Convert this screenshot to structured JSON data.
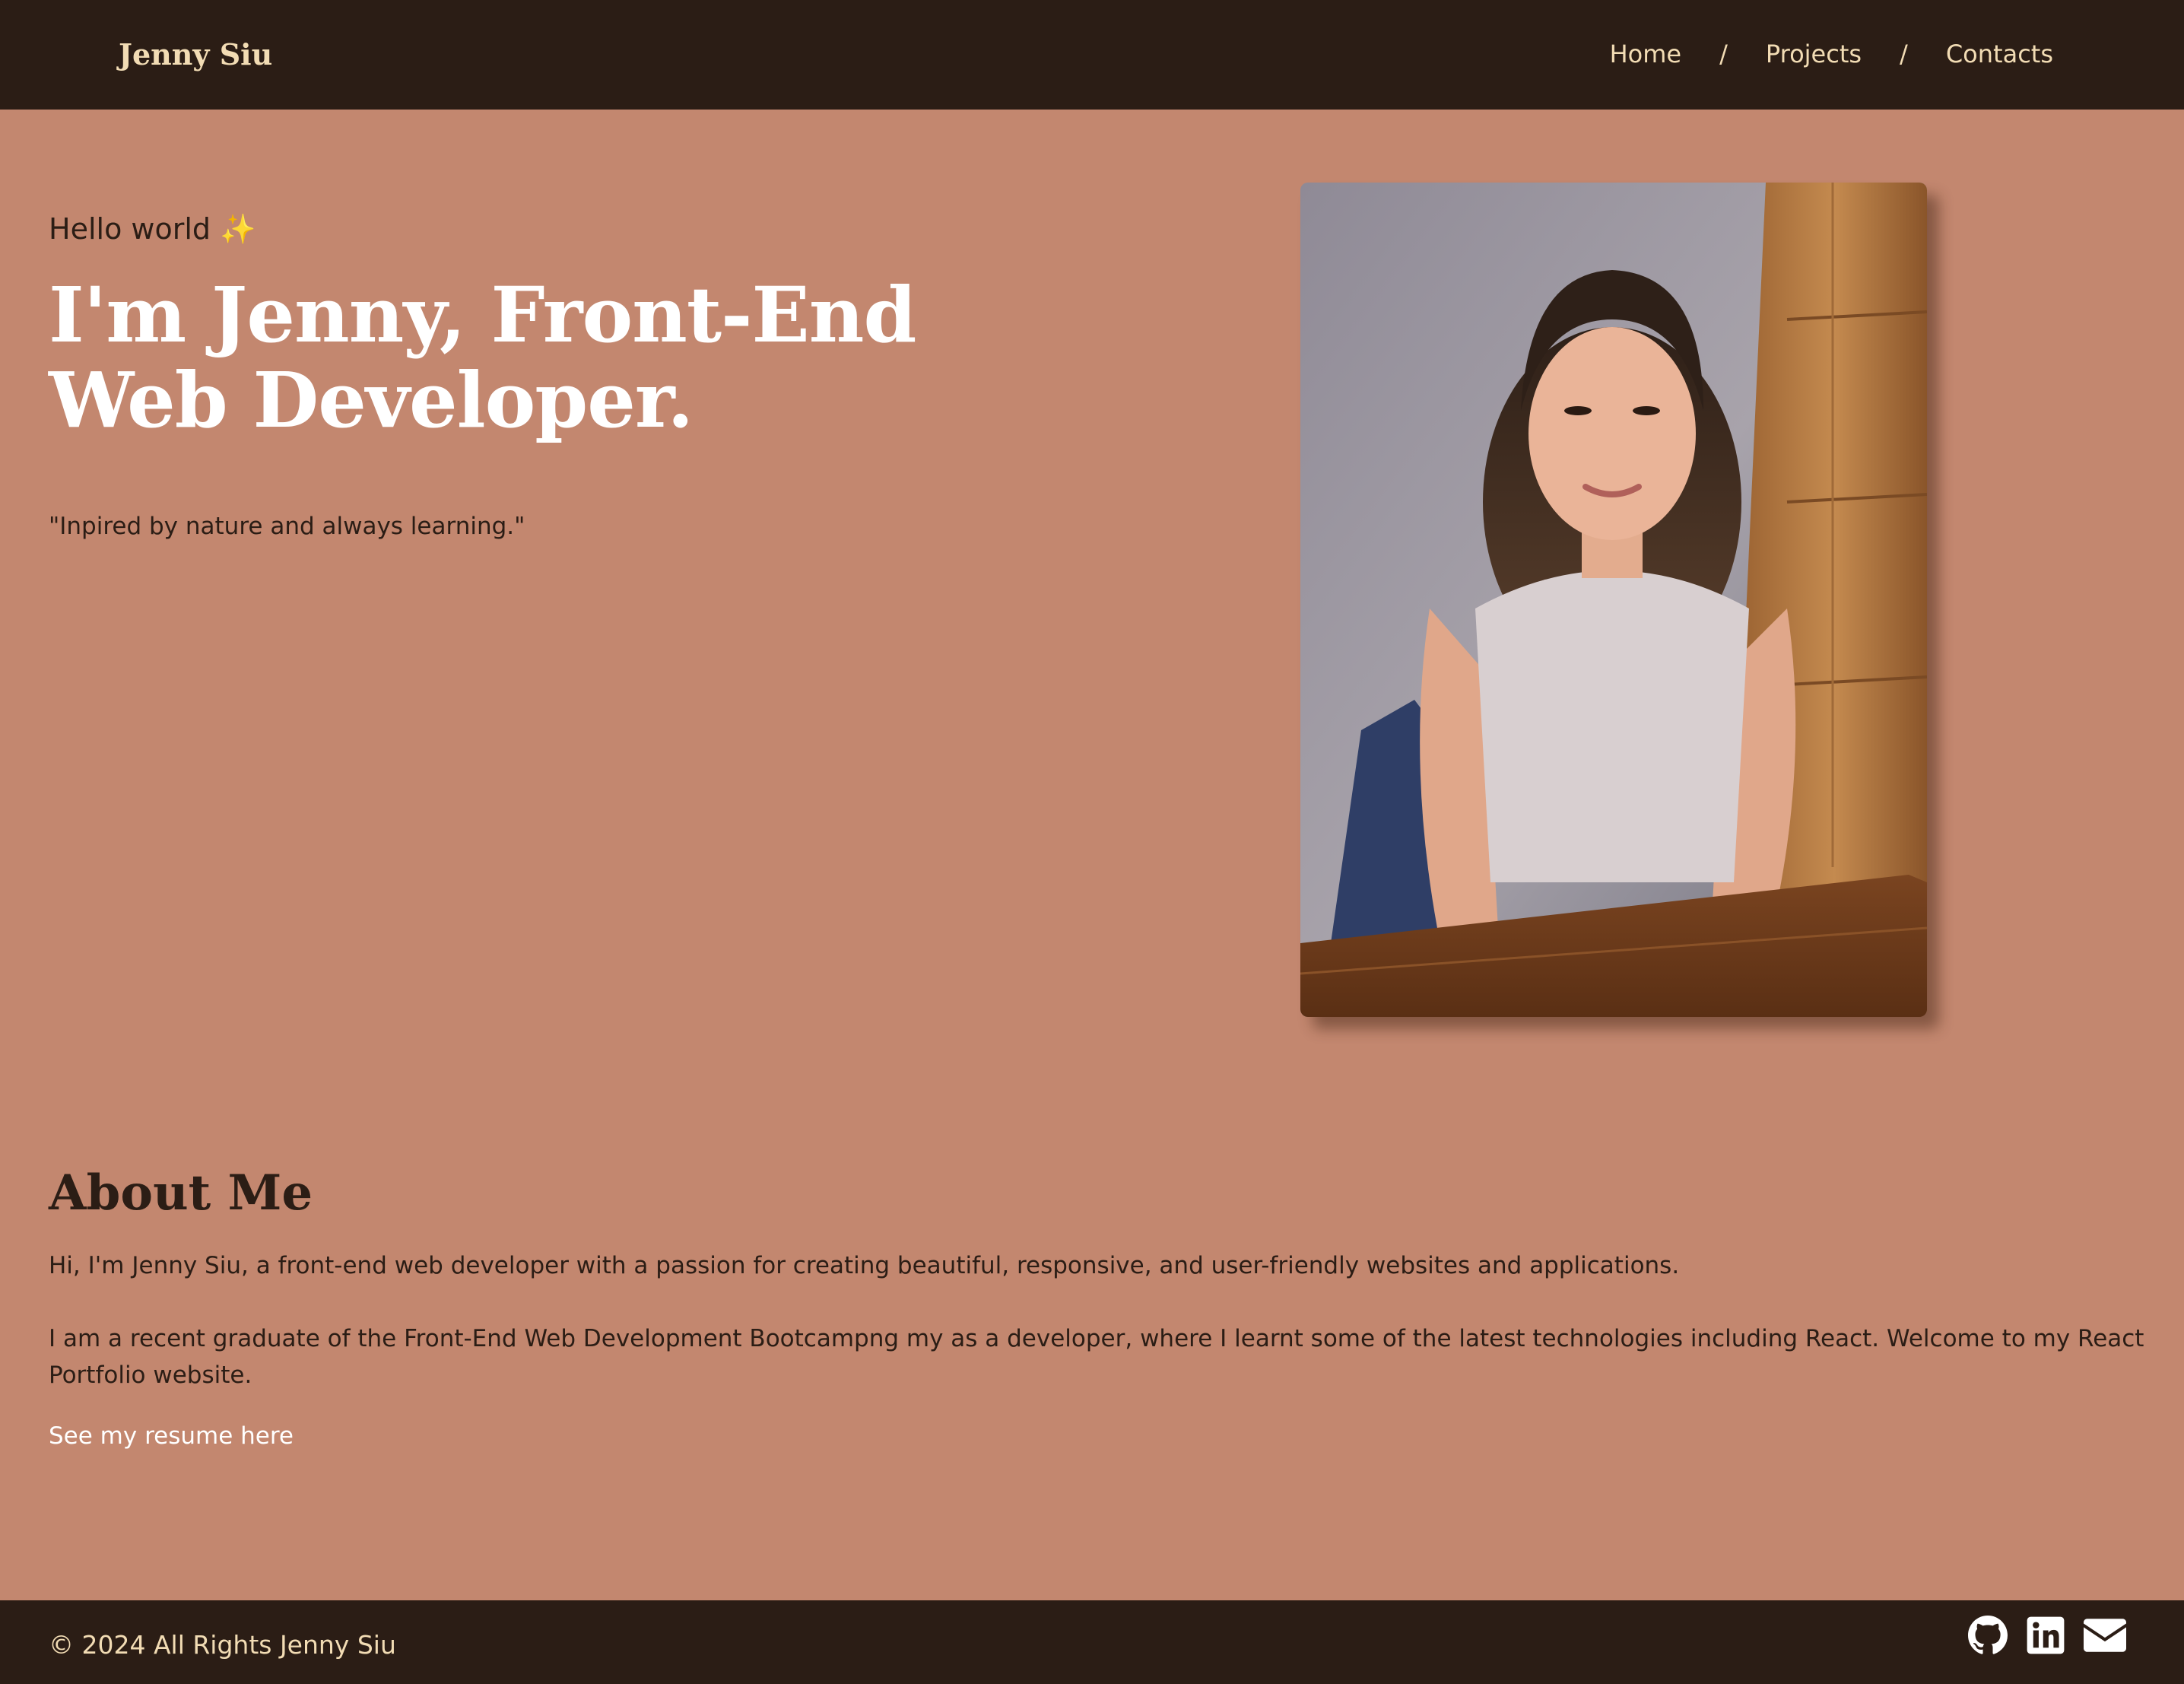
{
  "header": {
    "brand": "Jenny Siu",
    "nav": {
      "home": "Home",
      "projects": "Projects",
      "contacts": "Contacts",
      "separator": "/"
    }
  },
  "hero": {
    "greeting": "Hello world",
    "greeting_emoji": "✨",
    "title": "I'm Jenny, Front-End Web Developer.",
    "tagline": "\"Inpired by nature and always learning.\""
  },
  "about": {
    "title": "About Me",
    "paragraph1": "Hi, I'm Jenny Siu, a front-end web developer with a passion for creating beautiful, responsive, and user-friendly websites and applications.",
    "paragraph2": "I am a recent graduate of the Front-End Web Development Bootcampng my as a developer, where I learnt some of the latest technologies including React. Welcome to my React Portfolio website.",
    "resume_link": "See my resume here"
  },
  "footer": {
    "copyright": "© 2024 All Rights Jenny Siu",
    "icons": [
      "github-icon",
      "linkedin-icon",
      "envelope-icon"
    ]
  },
  "colors": {
    "background": "#c3876f",
    "header_footer": "#2b1d15",
    "accent_text": "#f2dcb4",
    "heading_white": "#ffffff"
  }
}
